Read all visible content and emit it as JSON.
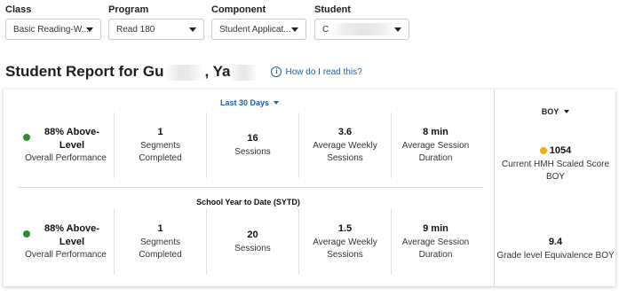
{
  "filters": {
    "class": {
      "label": "Class",
      "value": "Basic Reading-W..."
    },
    "program": {
      "label": "Program",
      "value": "Read 180"
    },
    "component": {
      "label": "Component",
      "value": "Student Applicat..."
    },
    "student": {
      "label": "Student",
      "value": "C"
    }
  },
  "report": {
    "title_prefix": "Student Report for Gu",
    "title_mid": ", Ya",
    "help_link": "How do I read this?"
  },
  "period": {
    "selected": "Last 30 Days",
    "metrics": {
      "performance_pct": "88% Above-Level",
      "performance_label": "Overall Performance",
      "segments_value": "1",
      "segments_label": "Segments Completed",
      "sessions_value": "16",
      "sessions_label": "Sessions",
      "weekly_value": "3.6",
      "weekly_label": "Average Weekly Sessions",
      "duration_value": "8 min",
      "duration_label": "Average Session Duration"
    }
  },
  "sytd": {
    "heading": "School Year to Date (SYTD)",
    "metrics": {
      "performance_pct": "88% Above-Level",
      "performance_label": "Overall Performance",
      "segments_value": "1",
      "segments_label": "Segments Completed",
      "sessions_value": "20",
      "sessions_label": "Sessions",
      "weekly_value": "1.5",
      "weekly_label": "Average Weekly Sessions",
      "duration_value": "9 min",
      "duration_label": "Average Session Duration"
    }
  },
  "benchmark": {
    "selected": "BOY",
    "score_value": "1054",
    "score_label": "Current HMH Scaled Score BOY",
    "grade_value": "9.4",
    "grade_label": "Grade level Equivalence BOY"
  },
  "colors": {
    "link": "#1b5fa8",
    "status_green": "#2e8b2e",
    "status_yellow": "#e8b10e"
  }
}
